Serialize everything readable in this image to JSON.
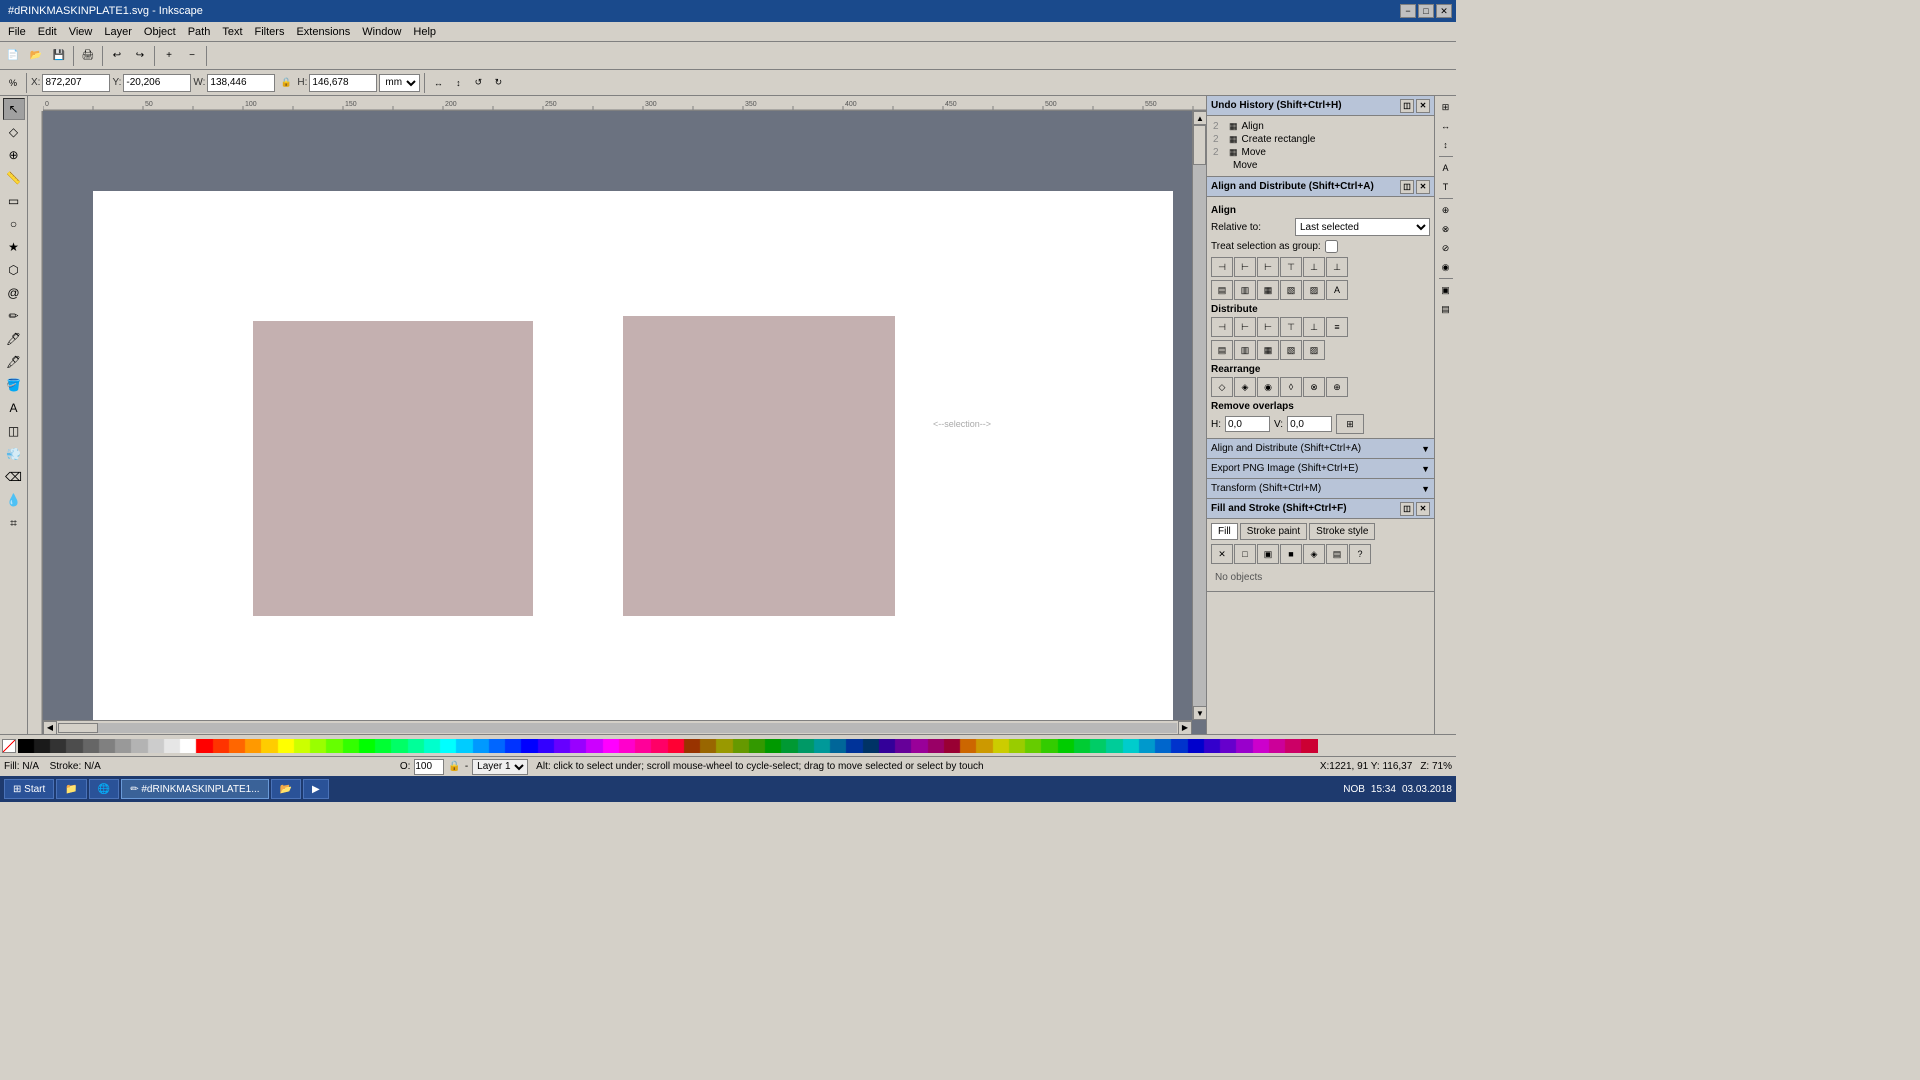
{
  "titlebar": {
    "text": "#dRINKMASKINPLATE1.svg - Inkscape",
    "btn_min": "−",
    "btn_max": "□",
    "btn_close": "✕"
  },
  "menubar": {
    "items": [
      "File",
      "Edit",
      "View",
      "Layer",
      "Object",
      "Path",
      "Text",
      "Filters",
      "Extensions",
      "Window",
      "Help"
    ]
  },
  "toolbar": {
    "coords": {
      "x_label": "X:",
      "x_val": "872,207",
      "y_label": "Y:",
      "y_val": "-20,206",
      "w_label": "W:",
      "w_val": "138,446",
      "h_label": "H:",
      "h_val": "146,678",
      "unit": "mm"
    }
  },
  "undo_history": {
    "title": "Undo History (Shift+Ctrl+H)",
    "items": [
      {
        "num": "2",
        "icon": "▦",
        "label": "Align"
      },
      {
        "num": "2",
        "icon": "▦",
        "label": "Create rectangle"
      },
      {
        "num": "2",
        "icon": "▦",
        "label": "Move"
      },
      {
        "num": "",
        "icon": "",
        "label": "Move"
      }
    ]
  },
  "align_distribute": {
    "title": "Align and Distribute (Shift+Ctrl+A)",
    "align_label": "Align",
    "relative_to_label": "Relative to:",
    "relative_to_value": "Last selected",
    "treat_as_group_label": "Treat selection as group:",
    "distribute_label": "Distribute",
    "rearrange_label": "Rearrange",
    "remove_overlaps_label": "Remove overlaps",
    "h_overlap_val": "0,0",
    "v_overlap_val": "0,0"
  },
  "panels": {
    "align_distribute_collapsed": "Align and Distribute (Shift+Ctrl+A)",
    "export_png_collapsed": "Export PNG Image (Shift+Ctrl+E)",
    "transform_collapsed": "Transform (Shift+Ctrl+M)",
    "fill_stroke_title": "Fill and Stroke (Shift+Ctrl+F)",
    "fill_tab": "Fill",
    "stroke_paint_tab": "Stroke paint",
    "stroke_style_tab": "Stroke style",
    "no_objects": "No objects"
  },
  "fill_buttons": [
    "✕",
    "□",
    "▣",
    "■",
    "◈",
    "▤",
    "?"
  ],
  "status": {
    "fill_label": "Fill:",
    "fill_val": "N/A",
    "stroke_label": "Stroke:",
    "stroke_val": "N/A",
    "opacity_label": "O:",
    "opacity_val": "100",
    "layer_label": "",
    "layer_val": "Layer 1",
    "message": "Alt: click to select under; scroll mouse-wheel to cycle-select; drag to move selected or select by touch",
    "coords": "X:1221, 91  Y: 116,37",
    "zoom": "71%"
  },
  "datetime": {
    "time": "15:34",
    "date": "03.03.2018"
  },
  "taskbar_items": [
    "Explorer",
    "Firefox",
    "Inkscape",
    "File Manager",
    "Media Player"
  ],
  "colors": {
    "canvas_bg": "#6b7280",
    "rect_fill": "#c4b0b0",
    "accent": "#1a4a8c"
  }
}
